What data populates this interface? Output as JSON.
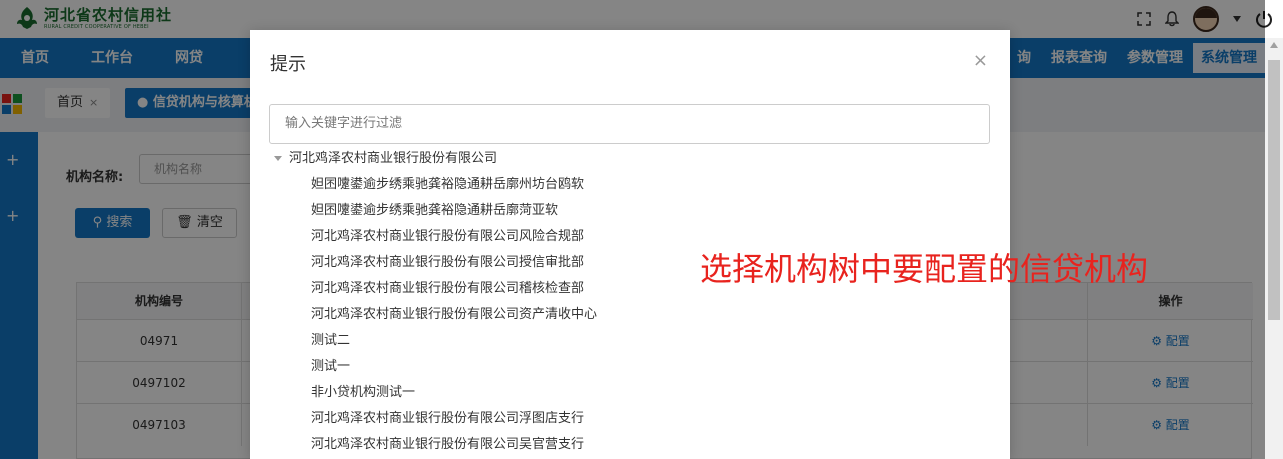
{
  "logo": {
    "title": "河北省农村信用社",
    "subtitle": "RURAL CREDIT COOPERATIVE OF HEBEI"
  },
  "header_icons": [
    "fullscreen-icon",
    "bell-icon",
    "avatar",
    "caret-down-icon",
    "power-icon"
  ],
  "nav": {
    "left_items": [
      "首页",
      "工作台",
      "网贷"
    ],
    "right_items": [
      "询",
      "报表查询",
      "参数管理",
      "系统管理"
    ]
  },
  "tabs": {
    "home": "首页",
    "home_close": "×",
    "active": "● 信贷机构与核算机"
  },
  "search_form": {
    "org_label": "机构名称:",
    "org_placeholder": "机构名称",
    "search_button": "搜索",
    "clear_button": "清空"
  },
  "table": {
    "headers": {
      "id": "机构编号",
      "action": "操作"
    },
    "rows": [
      {
        "id": "04971",
        "action": "配置"
      },
      {
        "id": "0497102",
        "action": "配置"
      },
      {
        "id": "0497103",
        "action": "配置"
      }
    ]
  },
  "dialog": {
    "title": "提示",
    "close": "×",
    "filter_placeholder": "输入关键字进行过滤",
    "tree": {
      "root": "河北鸡泽农村商业银行股份有限公司",
      "children": [
        "妲囨嚔鍙逾步绣乘驰龚裕隐通耕岳廓州坊台鸥软",
        "妲囨嚔鍙逾步绣乘驰龚裕隐通耕岳廓菏亚软",
        "河北鸡泽农村商业银行股份有限公司风险合规部",
        "河北鸡泽农村商业银行股份有限公司授信审批部",
        "河北鸡泽农村商业银行股份有限公司稽核检查部",
        "河北鸡泽农村商业银行股份有限公司资产清收中心",
        "测试二",
        "测试一",
        "非小贷机构测试一",
        "河北鸡泽农村商业银行股份有限公司浮图店支行",
        "河北鸡泽农村商业银行股份有限公司吴官营支行"
      ]
    },
    "annotation": "选择机构树中要配置的信贷机构"
  },
  "colors": {
    "primary": "#1578c8",
    "annotation": "#e8231e",
    "logo_green": "#1a6b2e"
  }
}
